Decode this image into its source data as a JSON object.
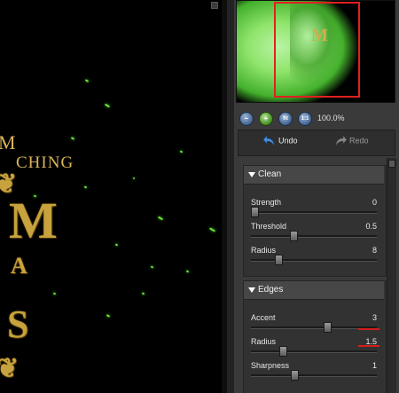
{
  "canvas": {
    "text_line1": "M",
    "text_line2": "CHING",
    "logo_big": "M",
    "logo_mid": "A",
    "logo_small": "S"
  },
  "navigator": {
    "logo_glyph": "M",
    "viewport_color": "#e02020"
  },
  "zoom": {
    "value": "100.0%",
    "buttons": [
      "zoom-out",
      "zoom-in",
      "fit",
      "actual-size"
    ],
    "button_glyphs": [
      "–",
      "+",
      "fit",
      "1:1"
    ]
  },
  "history": {
    "undo_label": "Undo",
    "redo_label": "Redo"
  },
  "sections": [
    {
      "title": "Clean",
      "controls": [
        {
          "label": "Strength",
          "value": "0",
          "level": 0.0
        },
        {
          "label": "Threshold",
          "value": "0.5",
          "level": 0.33
        },
        {
          "label": "Radius",
          "value": "8",
          "level": 0.2
        }
      ]
    },
    {
      "title": "Edges",
      "controls": [
        {
          "label": "Accent",
          "value": "3",
          "level": 0.62
        },
        {
          "label": "Radius",
          "value": "1.5",
          "level": 0.24
        },
        {
          "label": "Sharpness",
          "value": "1",
          "level": 0.34
        }
      ]
    }
  ],
  "colors": {
    "accent_green": "#6ee03c",
    "gold": "#c7a23d",
    "highlight_red": "#d21e1e"
  }
}
